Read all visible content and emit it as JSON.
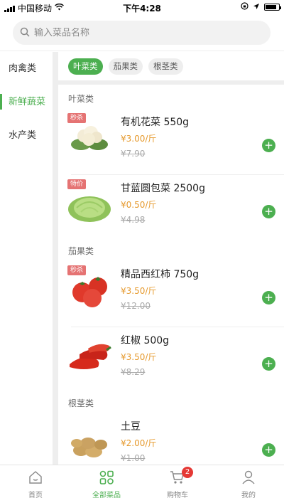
{
  "status_bar": {
    "carrier": "中国移动",
    "time": "下午4:28"
  },
  "search": {
    "placeholder": "输入菜品名称",
    "icon": "search-icon"
  },
  "sidebar": {
    "items": [
      {
        "label": "肉禽类",
        "active": false
      },
      {
        "label": "新鲜蔬菜",
        "active": true
      },
      {
        "label": "水产类",
        "active": false
      }
    ]
  },
  "subtabs": [
    {
      "label": "叶菜类",
      "active": true
    },
    {
      "label": "茄果类",
      "active": false
    },
    {
      "label": "根茎类",
      "active": false
    }
  ],
  "sections": [
    {
      "title": "叶菜类",
      "products": [
        {
          "badge": "秒杀",
          "name": "有机花菜 550g",
          "price": "¥3.00/斤",
          "old_price": "¥7.90",
          "image": "cauliflower"
        },
        {
          "badge": "特价",
          "name": "甘蓝圆包菜 2500g",
          "price": "¥0.50/斤",
          "old_price": "¥4.98",
          "image": "cabbage"
        }
      ]
    },
    {
      "title": "茄果类",
      "products": [
        {
          "badge": "秒杀",
          "name": "精品西红柿 750g",
          "price": "¥3.50/斤",
          "old_price": "¥12.00",
          "image": "tomato"
        },
        {
          "badge": "",
          "name": "红椒 500g",
          "price": "¥3.50/斤",
          "old_price": "¥8.29",
          "image": "red-pepper"
        }
      ]
    },
    {
      "title": "根茎类",
      "products": [
        {
          "badge": "",
          "name": "土豆",
          "price": "¥2.00/斤",
          "old_price": "¥1.00",
          "image": "potato"
        }
      ]
    }
  ],
  "tabbar": {
    "items": [
      {
        "label": "首页",
        "icon": "home-icon",
        "active": false
      },
      {
        "label": "全部菜品",
        "icon": "grid-icon",
        "active": true
      },
      {
        "label": "购物车",
        "icon": "cart-icon",
        "active": false,
        "badge": "2"
      },
      {
        "label": "我的",
        "icon": "user-icon",
        "active": false
      }
    ]
  },
  "colors": {
    "accent": "#4caf50",
    "price": "#e69a2e",
    "badge": "#e57373"
  }
}
